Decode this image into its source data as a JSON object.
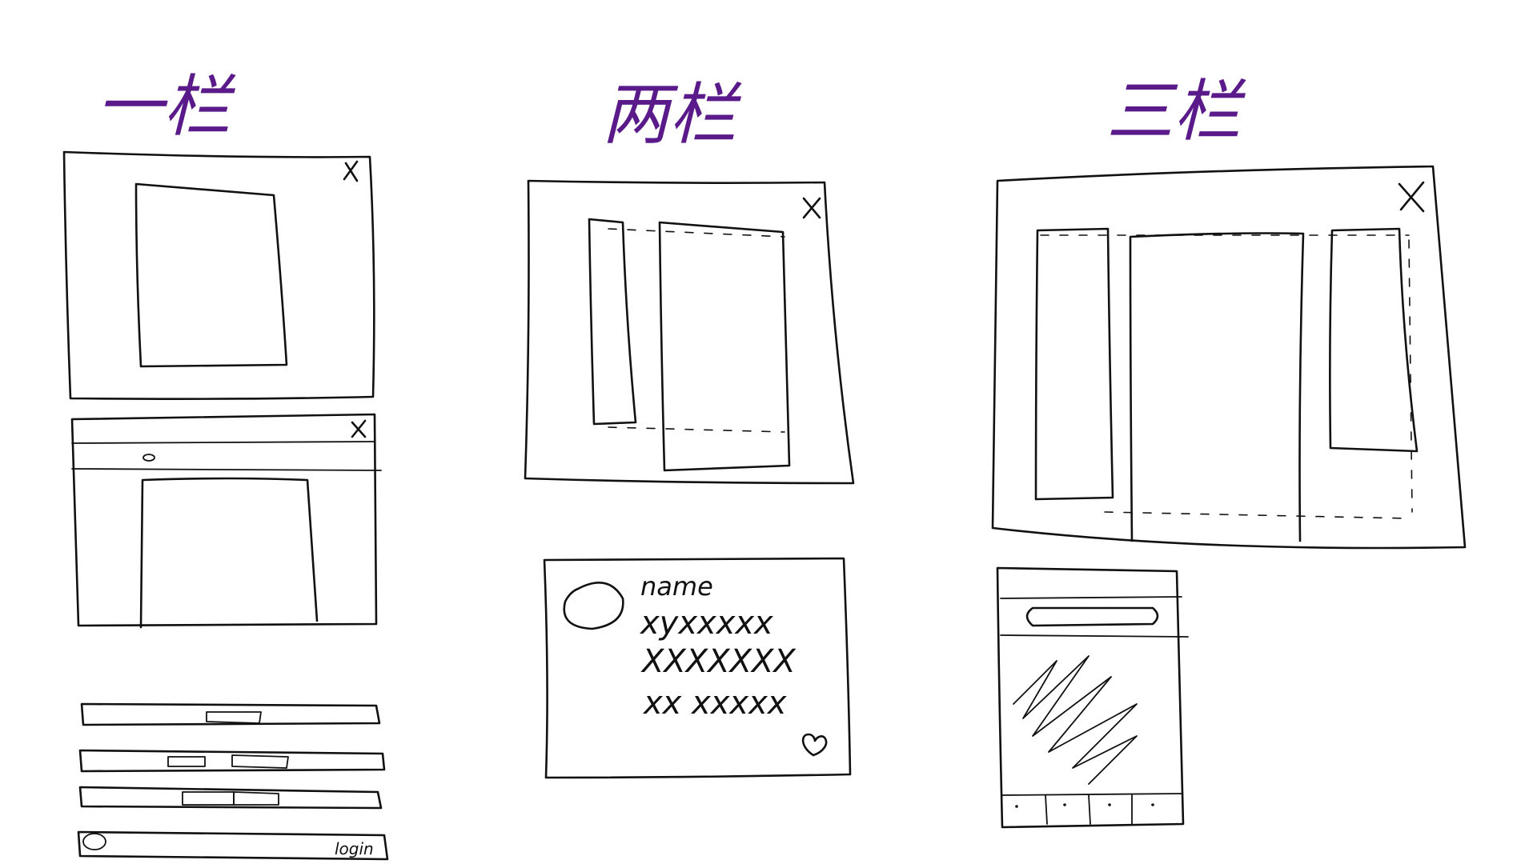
{
  "headings": {
    "one_column": "一栏",
    "two_column": "两栏",
    "three_column": "三栏"
  },
  "profile_card": {
    "name_label": "name",
    "line1": "xyxxxxx",
    "line2": "XXXXXXX",
    "line3": "xx xxxxx"
  },
  "login_bar": {
    "button_label": "login"
  },
  "colors": {
    "ink": "#111111",
    "heading_ink": "#5a1a8a"
  }
}
